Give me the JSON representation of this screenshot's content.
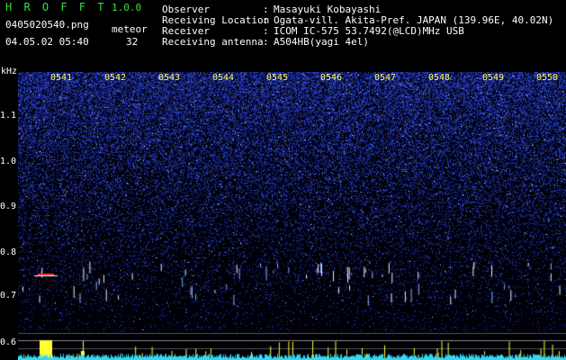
{
  "header": {
    "app_title": "H R O F F T",
    "app_version": "1.0.0",
    "file_name": "0405020540.png",
    "count_label": "meteor",
    "date_time": "04.05.02 05:40",
    "count_value": "32"
  },
  "station_info": [
    {
      "key": "Observer",
      "value": "Masayuki Kobayashi"
    },
    {
      "key": "Receiving Location",
      "value": "Ogata-vill. Akita-Pref. JAPAN (139.96E, 40.02N)"
    },
    {
      "key": "Receiver",
      "value": "ICOM IC-575 53.7492(@LCD)MHz USB"
    },
    {
      "key": "Receiving antenna",
      "value": "A504HB(yagi 4el)"
    }
  ],
  "axes": {
    "y_unit": "kHz",
    "y_ticks": [
      "1.1",
      "1.0",
      "0.9",
      "0.8",
      "0.7",
      "0.6"
    ],
    "x_ticks": [
      "0541",
      "0542",
      "0543",
      "0544",
      "0545",
      "0546",
      "0547",
      "0548",
      "0549",
      "0550"
    ]
  },
  "colors": {
    "background": "#000000",
    "noise_blue": "#1a28a8",
    "meteor_trace": "#ffffff",
    "meteor_head": "#ff3030",
    "baseline_cyan": "#35d6f0",
    "counter_yellow": "#ffff33",
    "tick_yellow": "#ffff66",
    "title_green": "#3fdc3f"
  }
}
